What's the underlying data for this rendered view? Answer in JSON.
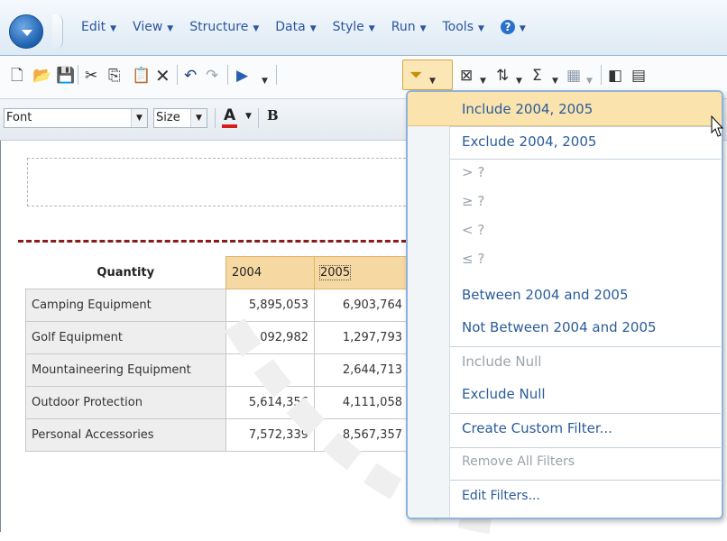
{
  "menubar": {
    "items": [
      {
        "label": "Edit"
      },
      {
        "label": "View"
      },
      {
        "label": "Structure"
      },
      {
        "label": "Data"
      },
      {
        "label": "Style"
      },
      {
        "label": "Run"
      },
      {
        "label": "Tools"
      }
    ]
  },
  "format_bar": {
    "font_value": "Font",
    "size_value": "Size",
    "font_color_glyph": "A",
    "bold_glyph": "B"
  },
  "crosstab": {
    "corner_label": "Quantity",
    "columns": [
      "2004",
      "2005"
    ],
    "rows": [
      {
        "label": "Camping Equipment",
        "values": [
          "5,895,053",
          "6,903,764"
        ]
      },
      {
        "label": "Golf Equipment",
        "values": [
          "1,092,982",
          "1,297,793"
        ]
      },
      {
        "label": "Mountaineering Equipment",
        "values": [
          "",
          "2,644,713"
        ]
      },
      {
        "label": "Outdoor Protection",
        "values": [
          "5,614,356",
          "4,111,058"
        ]
      },
      {
        "label": "Personal Accessories",
        "values": [
          "7,572,339",
          "8,567,357"
        ]
      }
    ]
  },
  "filter_menu": {
    "include": "Include 2004, 2005",
    "exclude": "Exclude 2004, 2005",
    "gt": "> ?",
    "gte": "≥ ?",
    "lt": "< ?",
    "lte": "≤ ?",
    "between": "Between 2004 and 2005",
    "not_between": "Not Between 2004 and 2005",
    "include_null": "Include Null",
    "exclude_null": "Exclude Null",
    "custom": "Create Custom Filter...",
    "remove_all": "Remove All Filters",
    "edit": "Edit Filters..."
  },
  "colors": {
    "menu_text": "#2b56a0",
    "highlight": "#fbe3ad",
    "header_cell": "#f6d8a3",
    "dashed_red": "#8b1a1a"
  }
}
